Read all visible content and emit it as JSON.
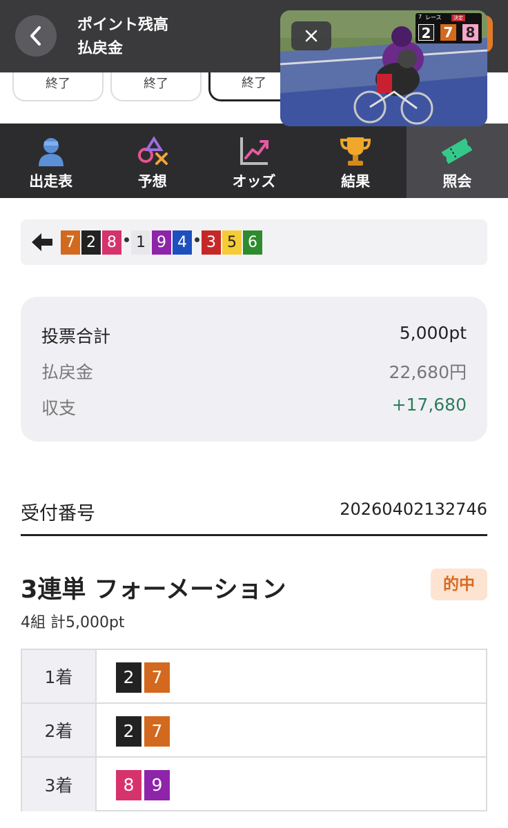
{
  "header": {
    "title_line1": "ポイント残高",
    "title_line2": "払戻金",
    "accent_color": "#e07a2a"
  },
  "status_tabs": [
    "終了",
    "終了",
    "終了"
  ],
  "video": {
    "race_no": "7",
    "race_label": "レース",
    "status_badge": "決定",
    "result_numbers": [
      "2",
      "7",
      "8"
    ]
  },
  "nav": {
    "items": [
      {
        "label": "出走表",
        "icon": "entry-list-icon"
      },
      {
        "label": "予想",
        "icon": "prediction-icon"
      },
      {
        "label": "オッズ",
        "icon": "odds-chart-icon"
      },
      {
        "label": "結果",
        "icon": "trophy-icon"
      },
      {
        "label": "照会",
        "icon": "ticket-icon"
      }
    ],
    "active_index": 4
  },
  "finish_order": {
    "groups": [
      [
        {
          "n": "7",
          "bg": "#d2691e",
          "fg": "#ffffff"
        },
        {
          "n": "2",
          "bg": "#222222",
          "fg": "#ffffff"
        },
        {
          "n": "8",
          "bg": "#d6336c",
          "fg": "#ffffff"
        }
      ],
      [
        {
          "n": "1",
          "bg": "#e8e8ec",
          "fg": "#222222"
        },
        {
          "n": "9",
          "bg": "#8e24aa",
          "fg": "#ffffff"
        },
        {
          "n": "4",
          "bg": "#1d4fbf",
          "fg": "#ffffff"
        }
      ],
      [
        {
          "n": "3",
          "bg": "#c62828",
          "fg": "#ffffff"
        },
        {
          "n": "5",
          "bg": "#f5cc33",
          "fg": "#222222"
        },
        {
          "n": "6",
          "bg": "#2e8b2e",
          "fg": "#ffffff"
        }
      ]
    ]
  },
  "summary": {
    "total_label": "投票合計",
    "total_value": "5,000pt",
    "payout_label": "払戻金",
    "payout_value": "22,680円",
    "balance_label": "収支",
    "balance_value": "+17,680",
    "balance_color": "#2e7d5b"
  },
  "receipt": {
    "label": "受付番号",
    "value": "20260402132746"
  },
  "bet": {
    "title": "3連単 フォーメーション",
    "hit_badge": "的中",
    "subtitle": "4組 計5,000pt",
    "rows": [
      {
        "label": "1着",
        "numbers": [
          {
            "n": "2",
            "bg": "#222222"
          },
          {
            "n": "7",
            "bg": "#d2691e"
          }
        ]
      },
      {
        "label": "2着",
        "numbers": [
          {
            "n": "2",
            "bg": "#222222"
          },
          {
            "n": "7",
            "bg": "#d2691e"
          }
        ]
      },
      {
        "label": "3着",
        "numbers": [
          {
            "n": "8",
            "bg": "#d6336c"
          },
          {
            "n": "9",
            "bg": "#8e24aa"
          }
        ]
      }
    ]
  }
}
